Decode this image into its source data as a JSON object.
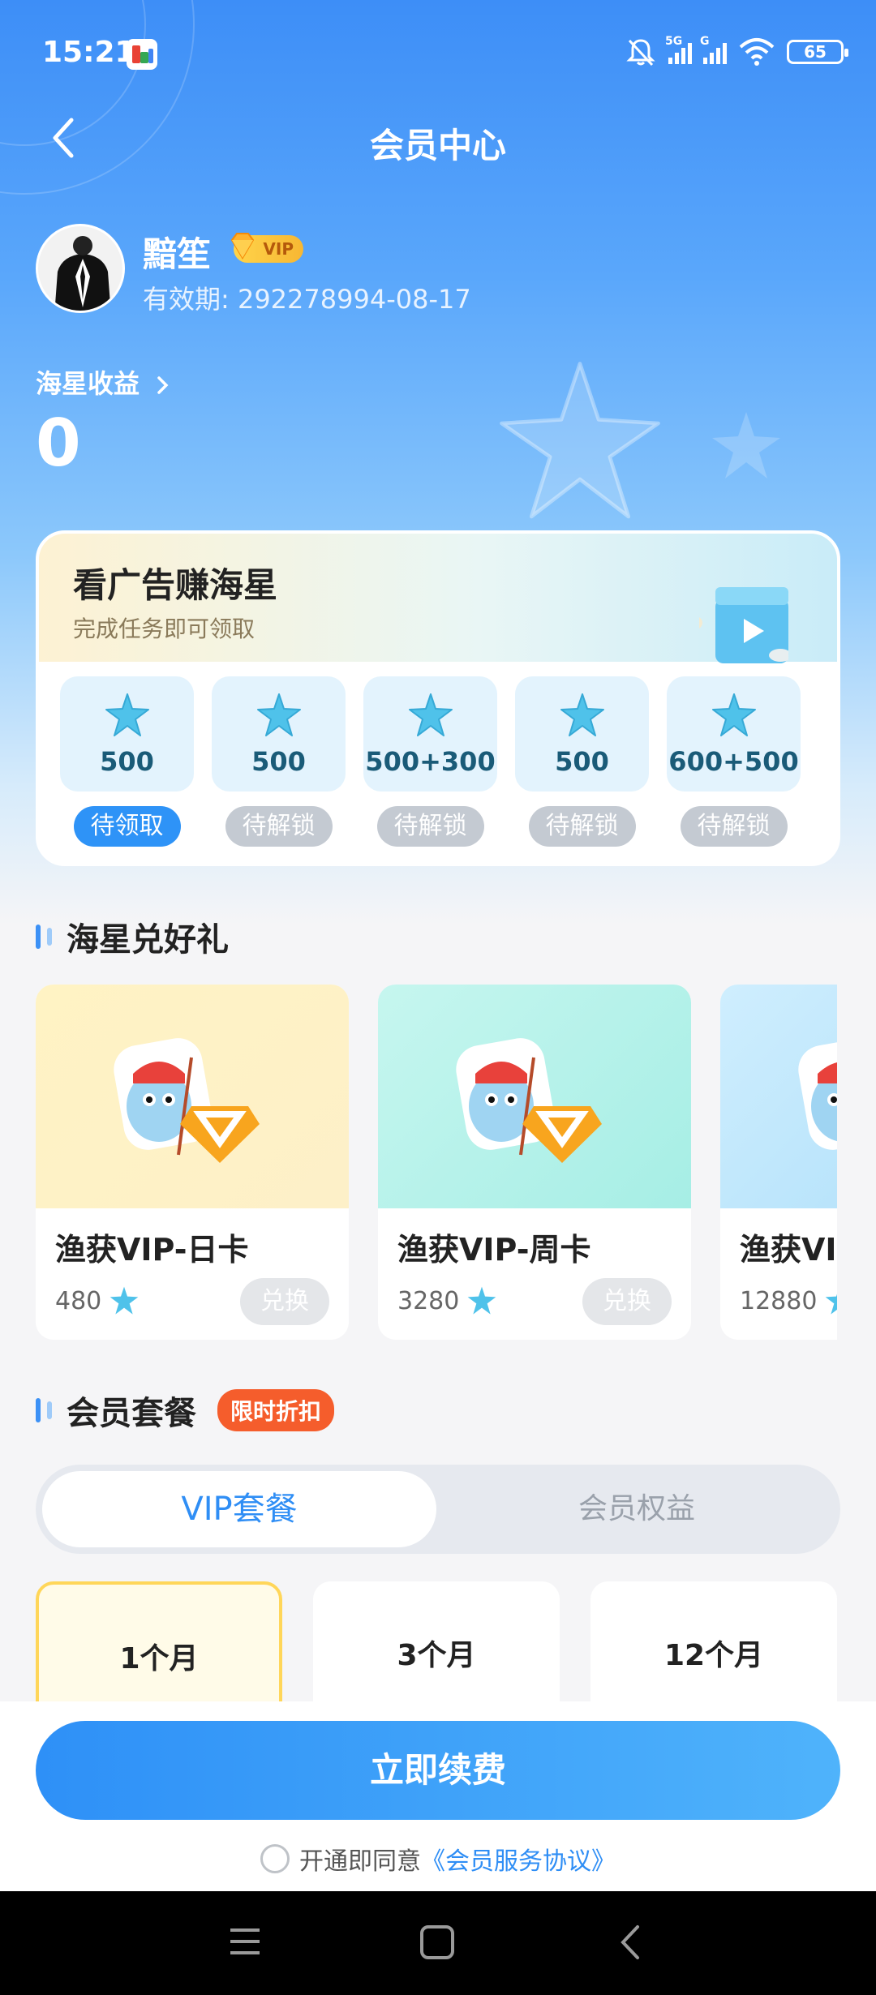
{
  "status": {
    "time": "15:21",
    "battery": "65",
    "net1": "5G",
    "net2": "G"
  },
  "header": {
    "title": "会员中心"
  },
  "user": {
    "name": "黯笙",
    "vip_badge": "VIP",
    "validity": "有效期: 292278994-08-17"
  },
  "income": {
    "label": "海星收益",
    "value": "0"
  },
  "ad_card": {
    "title": "看广告赚海星",
    "subtitle": "完成任务即可领取",
    "tasks": [
      {
        "value": "500",
        "button": "待领取"
      },
      {
        "value": "500",
        "button": "待解锁"
      },
      {
        "value": "500+300",
        "button": "待解锁"
      },
      {
        "value": "500",
        "button": "待解锁"
      },
      {
        "value": "600+500",
        "button": "待解锁"
      }
    ]
  },
  "gifts_section": {
    "title": "海星兑好礼",
    "items": [
      {
        "name": "渔获VIP-日卡",
        "price": "480",
        "button": "兑换"
      },
      {
        "name": "渔获VIP-周卡",
        "price": "3280",
        "button": "兑换"
      },
      {
        "name": "渔获VIP-月卡",
        "price": "12880",
        "button": ""
      }
    ]
  },
  "plans_section": {
    "title": "会员套餐",
    "badge": "限时折扣",
    "tabs": [
      "VIP套餐",
      "会员权益"
    ],
    "plans": [
      "1个月",
      "3个月",
      "12个月"
    ]
  },
  "footer": {
    "renew_button": "立即续费",
    "agree_text": "开通即同意",
    "agree_link": "《会员服务协议》"
  },
  "colors": {
    "primary": "#2e90f7",
    "accent": "#f55d2c"
  }
}
